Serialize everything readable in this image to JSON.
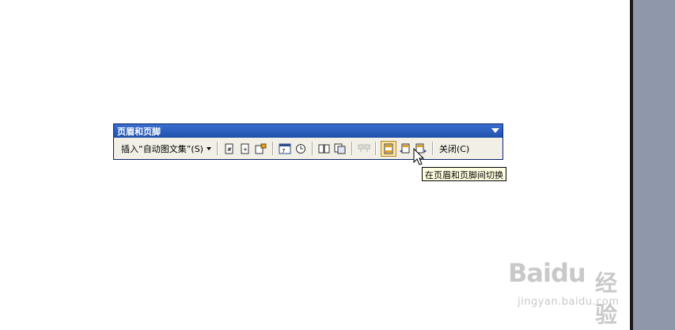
{
  "colors": {
    "title_bar": "#2b5fbd",
    "toolbar_bg": "#f1efe6",
    "side_panel": "#8f97ab",
    "active_button": "#ffe39b",
    "tooltip_bg": "#ffffe1"
  },
  "toolbar": {
    "title": "页眉和页脚",
    "insert_menu_label": "插入“自动图文集”(S)",
    "close_label": "关闭(C)",
    "buttons": [
      {
        "icon": "insert-page-number-icon"
      },
      {
        "icon": "insert-page-count-icon"
      },
      {
        "icon": "format-page-number-icon"
      },
      {
        "icon": "insert-date-icon"
      },
      {
        "icon": "insert-time-icon"
      },
      {
        "icon": "page-setup-icon"
      },
      {
        "icon": "show-hide-document-text-icon"
      },
      {
        "icon": "same-as-previous-icon",
        "disabled": true
      },
      {
        "icon": "switch-header-footer-icon",
        "active": true
      },
      {
        "icon": "show-previous-icon"
      },
      {
        "icon": "show-next-icon"
      }
    ]
  },
  "tooltip": {
    "text": "在页眉和页脚间切换"
  },
  "watermark": {
    "logo": "Baidu",
    "label": "经验",
    "url": "jingyan.baidu.com"
  }
}
